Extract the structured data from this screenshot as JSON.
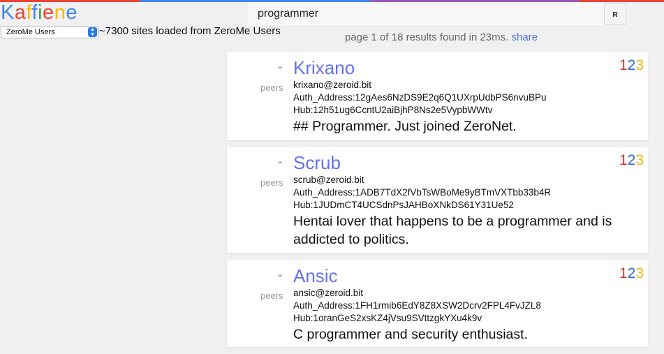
{
  "header": {
    "logo_letters": [
      {
        "ch": "K",
        "color": "#4285f4"
      },
      {
        "ch": "a",
        "color": "#ea4335"
      },
      {
        "ch": "f",
        "color": "#fbbc05"
      },
      {
        "ch": "f",
        "color": "#4285f4"
      },
      {
        "ch": "i",
        "color": "#34a853"
      },
      {
        "ch": "e",
        "color": "#ea4335"
      },
      {
        "ch": "n",
        "color": "#fbbc05"
      },
      {
        "ch": "e",
        "color": "#4285f4"
      }
    ],
    "search_value": "programmer",
    "r_button_label": "R",
    "top_line_colors": [
      "#ea4335",
      "#4285f4",
      "#9b59b6",
      "#ea4335"
    ]
  },
  "source": {
    "selected": "ZeroMe Users",
    "sites_loaded": "~7300 sites loaded from ZeroMe Users"
  },
  "results": {
    "status": "page 1 of 18 results found in 23ms.",
    "share_label": "share",
    "items": [
      {
        "dash": "-",
        "peers_label": "peers",
        "name": "Krixano",
        "email": "krixano@zeroid.bit",
        "auth": "Auth_Address:12gAes6NzDS9E2q6Q1UXrpUdbPS6nvuBPu",
        "hub": "Hub:12h51ug6CcntU2aiBjhP8Ns2e5VypbWWtv",
        "description": "## Programmer. Just joined ZeroNet.",
        "rank": [
          "1",
          "2",
          "3"
        ]
      },
      {
        "dash": "-",
        "peers_label": "peers",
        "name": "Scrub",
        "email": "scrub@zeroid.bit",
        "auth": "Auth_Address:1ADB7TdX2fVbTsWBoMe9yBTmVXTbb33b4R",
        "hub": "Hub:1JUDmCT4UCSdnPsJAHBoXNkDS61Y31Ue52",
        "description": "Hentai lover that happens to be a programmer and is addicted to politics.",
        "rank": [
          "1",
          "2",
          "3"
        ]
      },
      {
        "dash": "-",
        "peers_label": "peers",
        "name": "Ansic",
        "email": "ansic@zeroid.bit",
        "auth": "Auth_Address:1FH1rmib6EdY8Z8XSW2Dcrv2FPL4FvJZL8",
        "hub": "Hub:1oranGeS2xsKZ4jVsu9SVttzgkYXu4k9v",
        "description": "C programmer and security enthusiast.",
        "rank": [
          "1",
          "2",
          "3"
        ]
      }
    ],
    "rank_colors": [
      "#d93025",
      "#3367d6",
      "#f2b400"
    ]
  }
}
